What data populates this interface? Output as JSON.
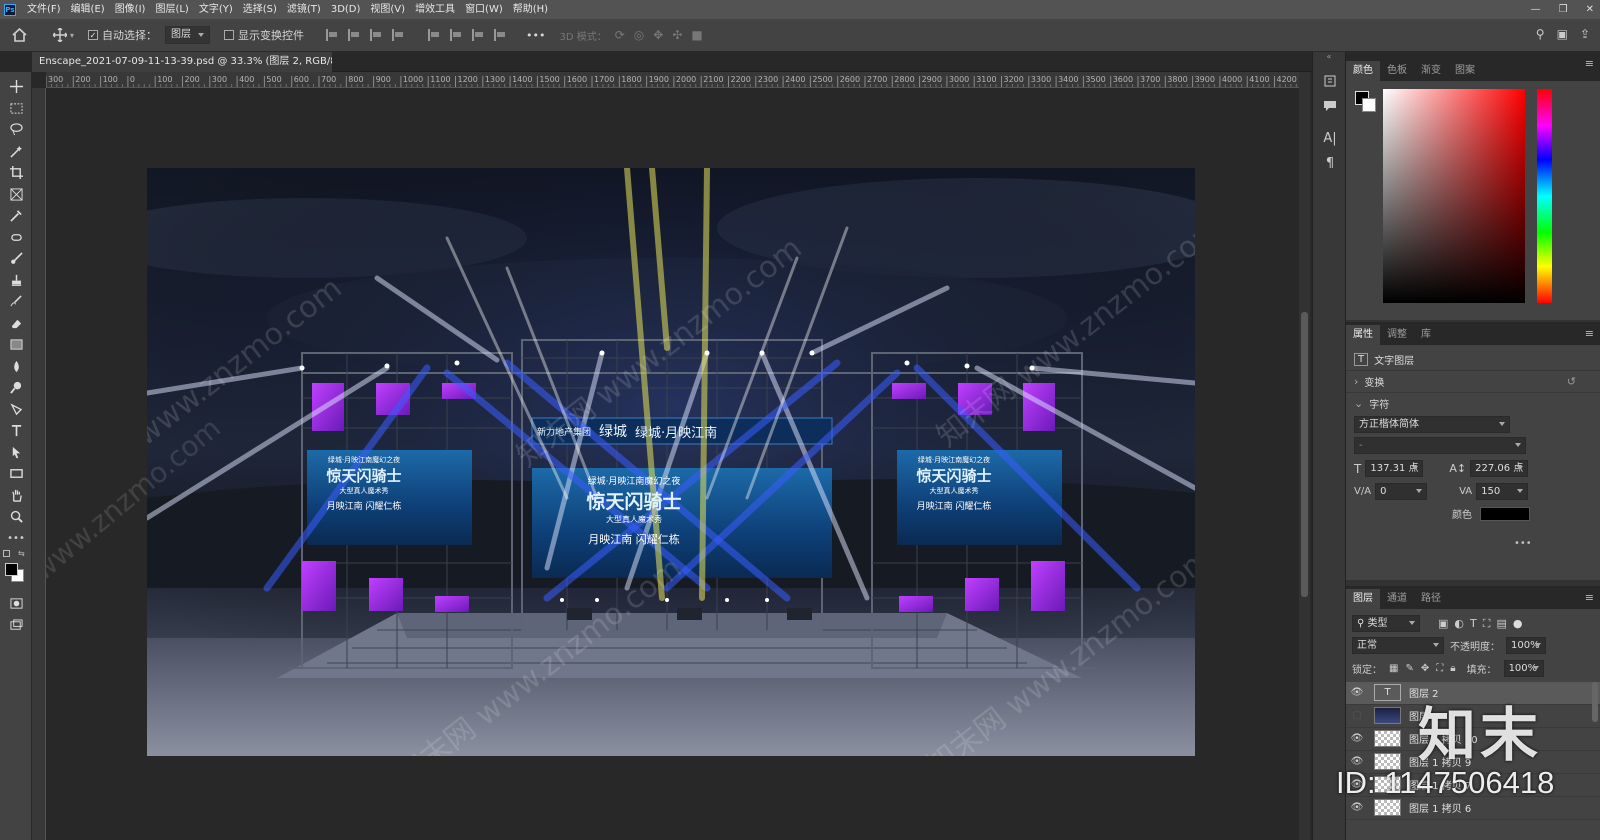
{
  "menubar": {
    "logo": "Ps",
    "items": [
      "文件(F)",
      "编辑(E)",
      "图像(I)",
      "图层(L)",
      "文字(Y)",
      "选择(S)",
      "滤镜(T)",
      "3D(D)",
      "视图(V)",
      "增效工具",
      "窗口(W)",
      "帮助(H)"
    ]
  },
  "options": {
    "auto_select_label": "自动选择：",
    "auto_select_value": "图层",
    "show_transform_label": "显示变换控件",
    "more": "•••",
    "mode_3d": "3D 模式："
  },
  "document": {
    "tab_title": "Enscape_2021-07-09-11-13-39.psd @ 33.3% (图层 2, RGB/8#) *",
    "close": "×"
  },
  "ruler": {
    "h_ticks": [
      "300",
      "200",
      "100",
      "0",
      "100",
      "200",
      "300",
      "400",
      "500",
      "600",
      "700",
      "800",
      "900",
      "1000",
      "1100",
      "1200",
      "1300",
      "1400",
      "1500",
      "1600",
      "1700",
      "1800",
      "1900",
      "2000",
      "2100",
      "2200",
      "2300",
      "2400",
      "2500",
      "2600",
      "2700",
      "2800",
      "2900",
      "3000",
      "3100",
      "3200",
      "3300",
      "3400",
      "3500",
      "3600",
      "3700",
      "3800",
      "3900",
      "4000",
      "4100",
      "4200"
    ]
  },
  "artwork": {
    "sponsor_left": "新力地产集团",
    "brand1": "绿城",
    "brand2": "绿城·月映江南",
    "main_top": "绿城·月映江南魔幻之夜",
    "main_title": "惊天闪骑士",
    "main_sub": "大型真人魔术秀",
    "main_slogan": "月映江南 闪耀仁栋",
    "side_top": "绿城·月映江南魔幻之夜",
    "side_title": "惊天闪骑士",
    "side_sub": "大型真人魔术秀",
    "side_slogan": "月映江南 闪耀仁栋"
  },
  "watermark": {
    "site": "知末网 www.znzmo.com",
    "brand": "知末",
    "id": "ID: 1147506418"
  },
  "color_panel": {
    "tabs": [
      "颜色",
      "色板",
      "渐变",
      "图案"
    ],
    "hue_color": "#ff0000"
  },
  "properties_panel": {
    "tabs": [
      "属性",
      "调整",
      "库"
    ],
    "layer_type": "文字图层",
    "transform": "变换",
    "character": "字符",
    "font_family": "方正楷体简体",
    "font_style": "-",
    "font_size": "137.31 点",
    "leading": "227.06 点",
    "kerning": "0",
    "tracking": "150",
    "color_label": "颜色",
    "more": "•••"
  },
  "layers_panel": {
    "tabs": [
      "图层",
      "通道",
      "路径"
    ],
    "filter": "类型",
    "blend_mode": "正常",
    "opacity_label": "不透明度：",
    "opacity": "100%",
    "lock_label": "锁定：",
    "fill_label": "填充：",
    "fill": "100%",
    "layers": [
      {
        "name": "图层 2",
        "visible": true
      },
      {
        "name": "图层",
        "visible": false
      },
      {
        "name": "图层 1 拷贝 10",
        "visible": true
      },
      {
        "name": "图层 1 拷贝 9",
        "visible": true
      },
      {
        "name": "图层 1 拷贝 7",
        "visible": true
      },
      {
        "name": "图层 1 拷贝 6",
        "visible": true
      }
    ]
  }
}
